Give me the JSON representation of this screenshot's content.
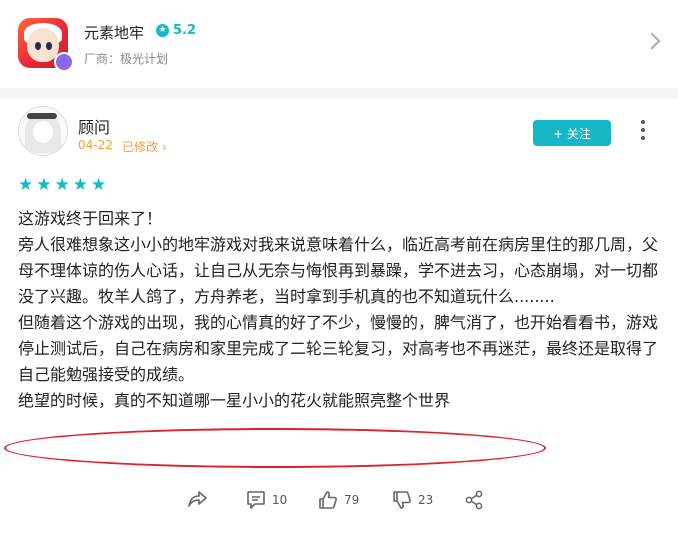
{
  "app": {
    "name": "元素地牢",
    "rating": "5.2",
    "maker": "厂商：极光计划"
  },
  "review": {
    "user_name": "顾问",
    "date": "04-22",
    "edited_label": "已修改",
    "follow_label": "+ 关注",
    "stars": 5,
    "paragraphs": [
      "这游戏终于回来了！",
      "旁人很难想象这小小的地牢游戏对我来说意味着什么，临近高考前在病房里住的那几周，父母不理体谅的伤人心话，让自己从无奈与悔恨再到暴躁，学不进去习，心态崩塌，对一切都没了兴趣。牧羊人鸽了，方舟养老，当时拿到手机真的也不知道玩什么........",
      "但随着这个游戏的出现，我的心情真的好了不少，慢慢的，脾气消了，也开始看看书，游戏停止测试后，自己在病房和家里完成了二轮三轮复习，对高考也不再迷茫，最终还是取得了自己能勉强接受的成绩。",
      "绝望的时候，真的不知道哪一星小小的花火就能照亮整个世界"
    ]
  },
  "actions": {
    "comments": "10",
    "likes": "79",
    "dislikes": "23"
  },
  "colors": {
    "accent": "#15b7c6",
    "date_orange": "#f0a23a",
    "highlight_red": "#e0212b"
  }
}
